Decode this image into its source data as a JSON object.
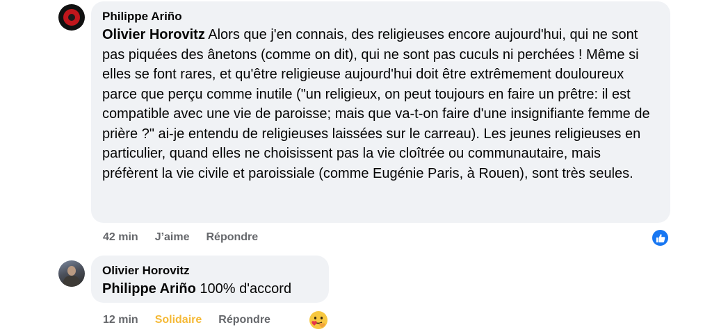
{
  "comment1": {
    "author": "Philippe Ariño",
    "mention": "Olivier Horovitz",
    "body": " Alors que j'en connais, des religieuses encore aujourd'hui, qui ne sont pas piquées des ânetons (comme on dit), qui ne sont pas cuculs ni perchées ! Même si elles se font rares, et qu'être religieuse aujourd'hui doit être extrêmement douloureux parce que perçu comme inutile (\"un religieux, on peut toujours en faire un prêtre: il est compatible avec une vie de paroisse; mais que va-t-on faire d'une insignifiante femme de prière ?\" ai-je entendu de religieuses laissées sur le carreau). Les jeunes religieuses en particulier, quand elles ne choisissent pas la vie cloîtrée ou communautaire, mais préfèrent la vie civile et paroissiale (comme Eugénie Paris, à Rouen), sont très seules.",
    "time": "42 min",
    "like_label": "J’aime",
    "reply_label": "Répondre",
    "reaction_icon": "like-icon",
    "reaction_color": "#1877f2"
  },
  "comment2": {
    "author": "Olivier Horovitz",
    "mention": "Philippe Ariño",
    "body": " 100% d'accord",
    "time": "12 min",
    "like_label": "Solidaire",
    "like_color": "#f5b936",
    "reply_label": "Répondre",
    "reaction_icon": "care-icon"
  }
}
